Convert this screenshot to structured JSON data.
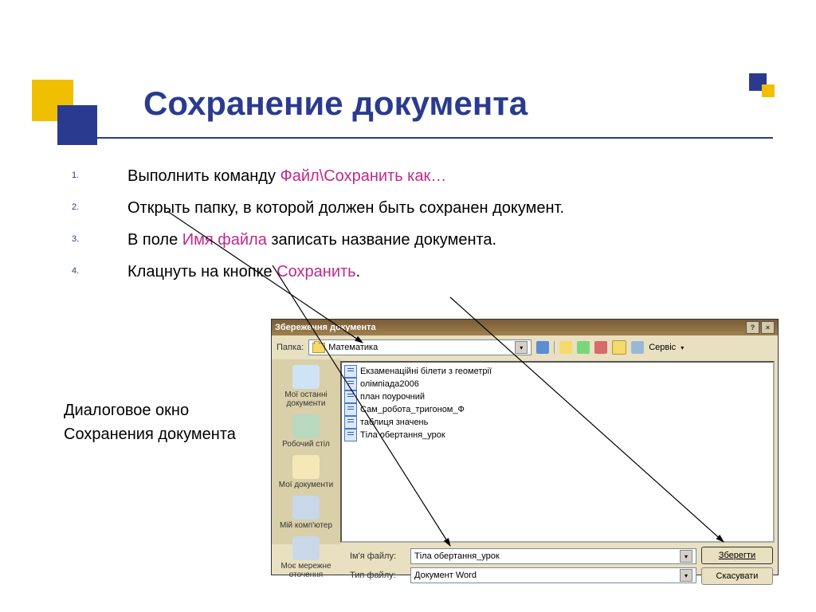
{
  "title": "Сохранение документа",
  "steps": {
    "1": {
      "num": "1.",
      "a": "Выполнить команду ",
      "b": "Файл\\Сохранить как…"
    },
    "2": {
      "num": "2.",
      "a": "Открыть папку, в которой должен быть сохранен документ."
    },
    "3": {
      "num": "3.",
      "a": "В поле ",
      "b": "Имя файла ",
      "c": "записать название документа."
    },
    "4": {
      "num": "4.",
      "a": "Клацнуть на кнопке ",
      "b": "Сохранить",
      "c": "."
    }
  },
  "caption": {
    "l1": "Диалоговое окно",
    "l2": "Сохранения документа"
  },
  "dialog": {
    "title": "Збереження документа",
    "folder_label": "Папка:",
    "folder_value": "Математика",
    "tools_label": "Сервіс",
    "places": {
      "0": "Мої останні документи",
      "1": "Робочий стіл",
      "2": "Мої документи",
      "3": "Мій комп'ютер",
      "4": "Моє мережне оточення"
    },
    "files": {
      "0": "Екзаменаційні білети з геометрії",
      "1": "олімпіада2006",
      "2": "план поурочний",
      "3": "Сам_робота_тригоном_Ф",
      "4": "таблиця значень",
      "5": "Тіла обертання_урок"
    },
    "filename_label": "Ім'я файлу:",
    "filename_value": "Тіла обертання_урок",
    "filetype_label": "Тип файлу:",
    "filetype_value": "Документ Word",
    "save_btn": "Зберегти",
    "cancel_btn": "Скасувати"
  }
}
